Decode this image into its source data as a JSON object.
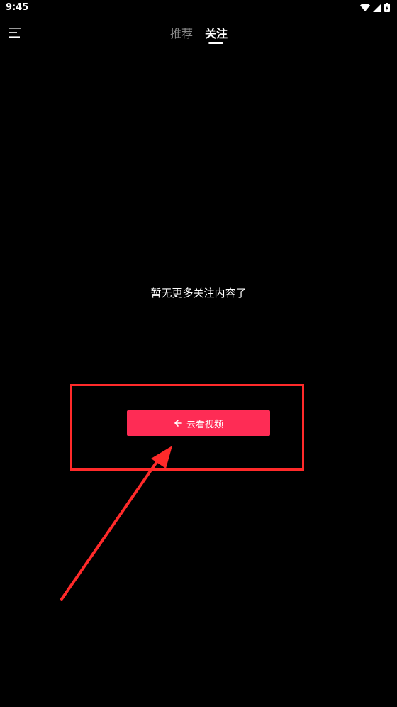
{
  "status_bar": {
    "time": "9:45",
    "icons": [
      "wifi-icon",
      "signal-icon",
      "battery-icon"
    ]
  },
  "top_nav": {
    "menu_icon": "menu-icon",
    "tabs": [
      {
        "label": "推荐",
        "active": false
      },
      {
        "label": "关注",
        "active": true
      }
    ]
  },
  "main": {
    "empty_message": "暂无更多关注内容了",
    "action_button": {
      "label": "去看视频",
      "icon": "arrow-left-icon"
    }
  },
  "colors": {
    "background": "#000000",
    "button": "#fe2c55",
    "annotation": "#ff2a2a",
    "inactive_tab": "#8a8a8a"
  }
}
